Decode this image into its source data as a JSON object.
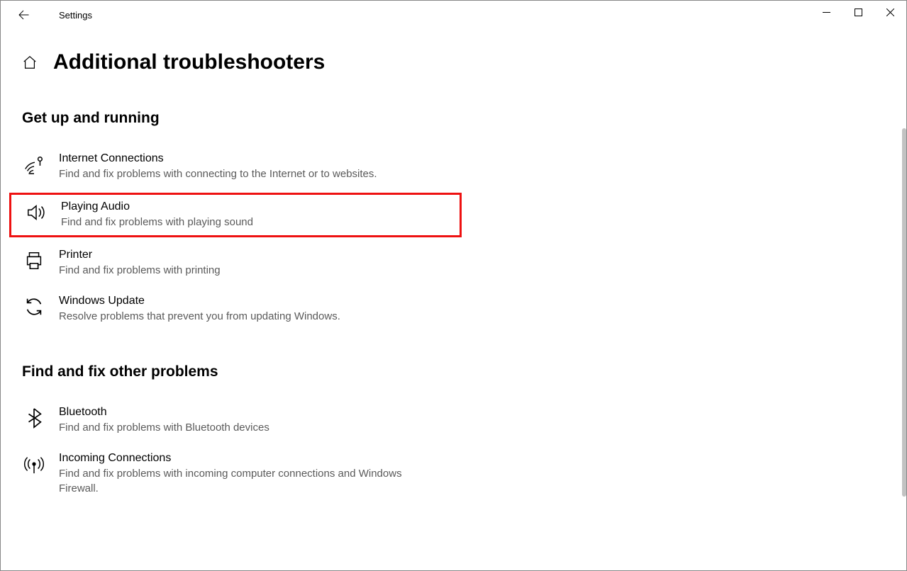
{
  "app": {
    "title": "Settings"
  },
  "page": {
    "title": "Additional troubleshooters"
  },
  "sections": {
    "get_up": {
      "title": "Get up and running",
      "items": [
        {
          "title": "Internet Connections",
          "desc": "Find and fix problems with connecting to the Internet or to websites."
        },
        {
          "title": "Playing Audio",
          "desc": "Find and fix problems with playing sound"
        },
        {
          "title": "Printer",
          "desc": "Find and fix problems with printing"
        },
        {
          "title": "Windows Update",
          "desc": "Resolve problems that prevent you from updating Windows."
        }
      ]
    },
    "other": {
      "title": "Find and fix other problems",
      "items": [
        {
          "title": "Bluetooth",
          "desc": "Find and fix problems with Bluetooth devices"
        },
        {
          "title": "Incoming Connections",
          "desc": "Find and fix problems with incoming computer connections and Windows Firewall."
        }
      ]
    }
  }
}
